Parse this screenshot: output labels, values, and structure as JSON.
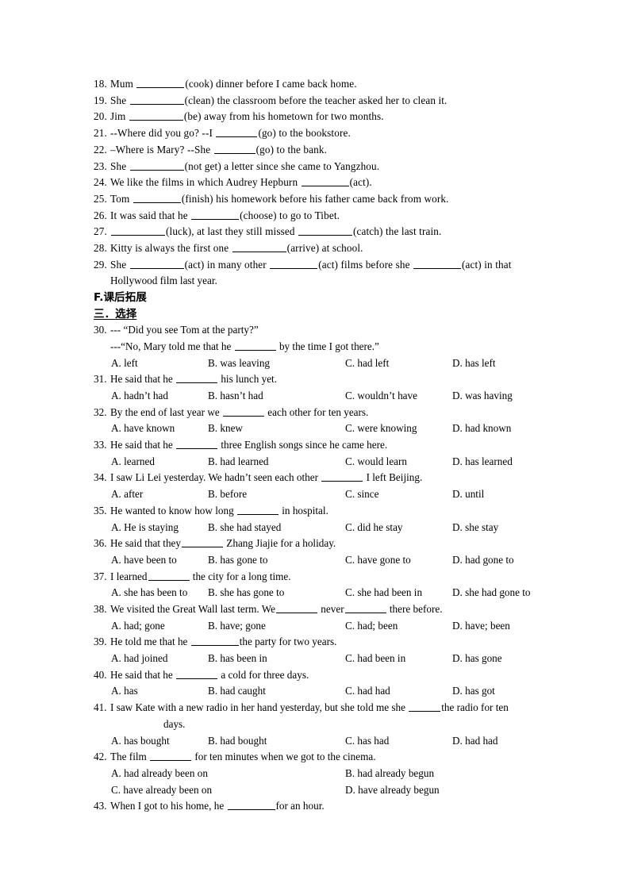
{
  "document": {
    "type": "english-grammar-worksheet",
    "page_background": "#ffffff",
    "text_color": "#000000"
  },
  "fill_in_blanks": [
    {
      "num": "18.",
      "pre": "Mum",
      "parts": [
        {
          "blank": "b-md"
        },
        {
          "text": "(cook) dinner before I came back home."
        }
      ]
    },
    {
      "num": "19.",
      "pre": "She",
      "parts": [
        {
          "blank": "b-lg"
        },
        {
          "text": "(clean) the classroom before the teacher asked her to clean it."
        }
      ]
    },
    {
      "num": "20.",
      "pre": "Jim",
      "parts": [
        {
          "blank": "b-lg"
        },
        {
          "text": "(be) away from his hometown for two months."
        }
      ]
    },
    {
      "num": "21.",
      "pre": "--Where did you go? --I",
      "parts": [
        {
          "blank": "b-sm"
        },
        {
          "text": "(go) to the bookstore."
        }
      ]
    },
    {
      "num": "22.",
      "pre": "–Where is Mary?    --She",
      "parts": [
        {
          "blank": "b-sm"
        },
        {
          "text": "(go) to the bank."
        }
      ]
    },
    {
      "num": "23.",
      "pre": "She",
      "parts": [
        {
          "blank": "b-lg"
        },
        {
          "text": "(not get) a letter since she came to Yangzhou."
        }
      ]
    },
    {
      "num": "24.",
      "pre": "We like the films in which Audrey Hepburn",
      "parts": [
        {
          "blank": "b-md"
        },
        {
          "text": "(act)."
        }
      ]
    },
    {
      "num": "25.",
      "pre": "Tom",
      "parts": [
        {
          "blank": "b-md"
        },
        {
          "text": "(finish) his homework before his father came back from work."
        }
      ]
    },
    {
      "num": "26.",
      "pre": "It was said that he",
      "parts": [
        {
          "blank": "b-md"
        },
        {
          "text": "(choose) to go to Tibet."
        }
      ]
    },
    {
      "num": "27.",
      "pre": "",
      "parts": [
        {
          "blank": "b-lg"
        },
        {
          "text": "(luck), at last they still missed"
        },
        {
          "blank": "b-lg"
        },
        {
          "text": "(catch) the last train."
        }
      ]
    },
    {
      "num": "28.",
      "pre": "Kitty is always the first one",
      "parts": [
        {
          "blank": "b-lg"
        },
        {
          "text": "(arrive) at school."
        }
      ]
    },
    {
      "num": "29.",
      "pre": "She",
      "parts": [
        {
          "blank": "b-lg"
        },
        {
          "text": "(act) in many other"
        },
        {
          "blank": "b-md"
        },
        {
          "text": "(act) films before she"
        },
        {
          "blank": "b-md"
        },
        {
          "text": "(act) in that"
        }
      ],
      "continuation": "Hollywood film last year."
    }
  ],
  "headings": {
    "section_f": "F.课后拓展",
    "section_three": "三．选择"
  },
  "multiple_choice": [
    {
      "num": "30.",
      "stem": "--- “Did you see Tom at the party?”",
      "sub": "---“No, Mary told me that he",
      "sub_blank": "b-sm",
      "sub_tail": "by the time I got there.”",
      "layout": "four",
      "options": [
        "A. left",
        "B. was leaving",
        "C. had left",
        "D. has left"
      ]
    },
    {
      "num": "31.",
      "stem_pre": "He said that he",
      "stem_blank": "b-sm",
      "stem_post": "his lunch yet.",
      "layout": "four",
      "options": [
        "A. hadn’t had",
        "B. hasn’t had",
        "C. wouldn’t have",
        "D. was having"
      ]
    },
    {
      "num": "32.",
      "stem_pre": "By the end of last year we",
      "stem_blank": "b-sm",
      "stem_post": "each other for ten years.",
      "layout": "four",
      "options": [
        "A. have known",
        "B. knew",
        "C. were knowing",
        "D. had known"
      ]
    },
    {
      "num": "33.",
      "stem_pre": "He said that he",
      "stem_blank": "b-sm",
      "stem_post": "three English songs since he came here.",
      "layout": "four",
      "options": [
        "A. learned",
        "B. had learned",
        "C. would learn",
        "D. has learned"
      ]
    },
    {
      "num": "34.",
      "stem_pre": "I saw Li Lei yesterday. We hadn’t seen each other",
      "stem_blank": "b-sm",
      "stem_post": "I left Beijing.",
      "layout": "four",
      "options": [
        "A. after",
        "B. before",
        "C. since",
        "D. until"
      ]
    },
    {
      "num": "35.",
      "stem_pre": "He wanted to know how long",
      "stem_blank": "b-sm",
      "stem_post": "in hospital.",
      "layout": "four",
      "options": [
        "A. He is staying",
        "B. she had stayed",
        "C. did he stay",
        "D. she stay"
      ]
    },
    {
      "num": "36.",
      "stem_pre": "He said that they",
      "stem_blank": "b-sm",
      "stem_post": "Zhang Jiajie for a holiday.",
      "tight": true,
      "layout": "four",
      "options": [
        "A. have been to",
        "B. has gone to",
        "C. have gone to",
        "D. had gone to"
      ]
    },
    {
      "num": "37.",
      "stem_pre": "I learned",
      "stem_blank": "b-sm",
      "stem_post": "the city for a long time.",
      "tight": true,
      "layout": "four",
      "options": [
        "A. she has been to",
        "B. she has gone to",
        "C. she had been in",
        "D. she had gone to"
      ]
    },
    {
      "num": "38.",
      "stem_pre": "We visited the Great Wall last term. We",
      "stem_blank": "b-sm",
      "stem_mid": "never",
      "stem_blank2": "b-sm",
      "stem_post": "there before.",
      "tight": true,
      "layout": "four",
      "options": [
        "A. had; gone",
        "B. have; gone",
        "C. had; been",
        "D. have; been"
      ]
    },
    {
      "num": "39.",
      "stem_pre": "He told me that he",
      "stem_blank": "b-md",
      "stem_post": "the party for two years.",
      "tight_after": true,
      "layout": "four",
      "options": [
        "A. had joined",
        "B. has been in",
        "C. had been in",
        "D. has gone"
      ]
    },
    {
      "num": "40.",
      "stem_pre": "He said that he",
      "stem_blank": "b-sm",
      "stem_post": "a cold for three days.",
      "layout": "four",
      "options": [
        "A. has",
        "B. had caught",
        "C. had had",
        "D. has got"
      ]
    },
    {
      "num": "41.",
      "stem_pre": "I saw Kate with a new radio in her hand yesterday, but she told me she",
      "stem_blank": "b-xs",
      "stem_post": "the radio for ten",
      "tight_after": true,
      "continuation": "days.",
      "layout": "four",
      "options": [
        "A. has bought",
        "B. had bought",
        "C. has had",
        "D. had had"
      ]
    },
    {
      "num": "42.",
      "stem_pre": "The film",
      "stem_blank": "b-sm",
      "stem_post": "for ten minutes when we got to the cinema.",
      "layout": "two",
      "options": [
        "A. had already been on",
        "B. had already begun",
        "C. have already been on",
        "D. have already begun"
      ]
    },
    {
      "num": "43.",
      "stem_pre": "When I got to his home, he",
      "stem_blank": "b-md",
      "stem_post": "for an hour.",
      "tight_after": true,
      "layout": "none",
      "options": []
    }
  ]
}
